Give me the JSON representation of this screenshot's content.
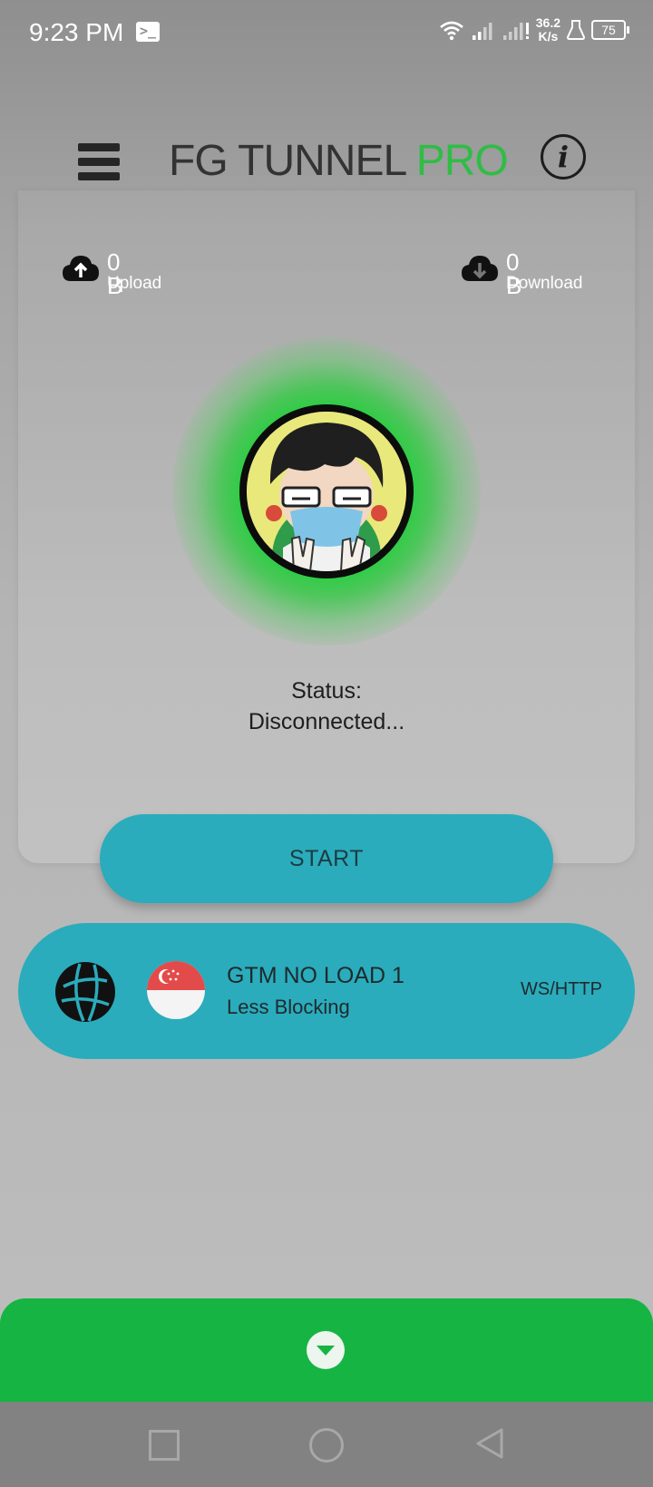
{
  "status_bar": {
    "time": "9:23 PM",
    "terminal_glyph": ">_",
    "net_speed_value": "36.2",
    "net_speed_unit": "K/s",
    "battery": "75",
    "icons": [
      "terminal-icon",
      "wifi-icon",
      "signal-icon",
      "signal-icon",
      "lab-flask-icon",
      "battery-icon"
    ]
  },
  "header": {
    "title_main": "FG TUNNEL",
    "title_accent": "PRO",
    "menu_icon": "hamburger-menu-icon",
    "info_icon": "info-icon",
    "info_glyph": "i"
  },
  "traffic": {
    "upload": {
      "value": "0 B",
      "label": "Upload",
      "icon": "cloud-upload-icon"
    },
    "download": {
      "value": "0 B",
      "label": "Download",
      "icon": "cloud-download-icon"
    }
  },
  "connection": {
    "status_label": "Status:",
    "status_text": "Disconnected..."
  },
  "start_button": {
    "label": "START"
  },
  "server": {
    "name": "GTM NO LOAD 1",
    "subtitle": "Less Blocking",
    "protocol": "WS/HTTP",
    "icon": "network-globe-icon",
    "flag": "singapore-flag-icon"
  },
  "bottom_panel": {
    "icon": "chevron-down-icon"
  },
  "nav_bar": {
    "icons": [
      "recents-square-icon",
      "home-circle-icon",
      "back-triangle-icon"
    ]
  },
  "colors": {
    "accent_green": "#16b443",
    "glow_green": "#2bcd43",
    "teal": "#2aacbc",
    "title_dark": "#333333"
  }
}
